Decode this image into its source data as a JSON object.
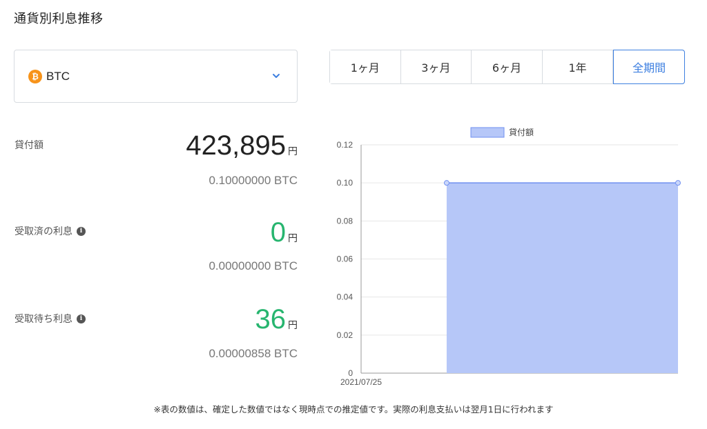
{
  "page_title": "通貨別利息推移",
  "currency_select": {
    "icon": "bitcoin-icon",
    "label": "BTC"
  },
  "period_tabs": [
    {
      "label": "1ヶ月",
      "active": false
    },
    {
      "label": "3ヶ月",
      "active": false
    },
    {
      "label": "6ヶ月",
      "active": false
    },
    {
      "label": "1年",
      "active": false
    },
    {
      "label": "全期間",
      "active": true
    }
  ],
  "stats": {
    "loan": {
      "label": "貸付額",
      "value": "423,895",
      "unit": "円",
      "btc": "0.10000000 BTC"
    },
    "received": {
      "label": "受取済の利息",
      "value": "0",
      "unit": "円",
      "btc": "0.00000000 BTC"
    },
    "pending": {
      "label": "受取待ち利息",
      "value": "36",
      "unit": "円",
      "btc": "0.00000858 BTC"
    }
  },
  "colors": {
    "accent": "#3d7fe0",
    "positive": "#27b56f",
    "area_fill": "#b6c7f8",
    "area_line": "#6f8ff0"
  },
  "chart_data": {
    "type": "area",
    "legend": "貸付額",
    "x_labels": [
      "2021/07/25"
    ],
    "y_ticks": [
      "0.12",
      "0.10",
      "0.08",
      "0.06",
      "0.04",
      "0.02",
      "0"
    ],
    "ylim": [
      0,
      0.12
    ],
    "series": [
      {
        "name": "貸付額",
        "points": [
          {
            "x": 0.27,
            "y": 0.1
          },
          {
            "x": 1.0,
            "y": 0.1
          }
        ]
      }
    ],
    "grid": true,
    "legend_position": "top"
  },
  "footnote": "※表の数値は、確定した数値ではなく現時点での推定値です。実際の利息支払いは翌月1日に行われます"
}
